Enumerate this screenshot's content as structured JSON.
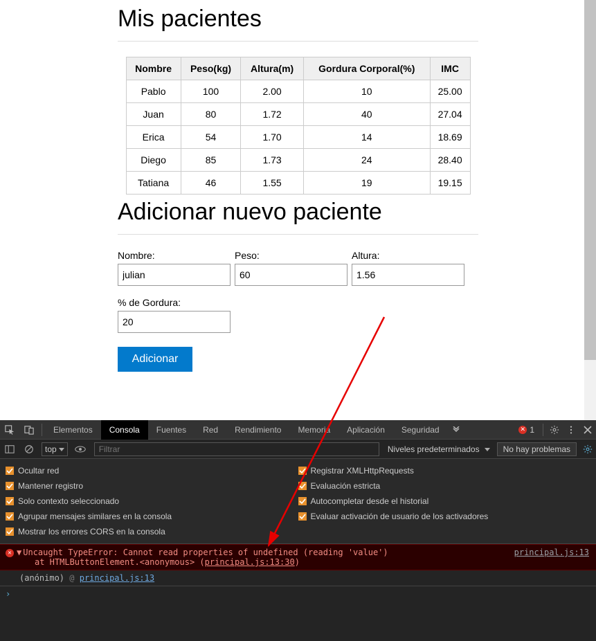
{
  "page": {
    "title": "Mis pacientes",
    "addTitle": "Adicionar nuevo paciente"
  },
  "table": {
    "headers": {
      "name": "Nombre",
      "weight": "Peso(kg)",
      "height": "Altura(m)",
      "fat": "Gordura Corporal(%)",
      "bmi": "IMC"
    },
    "rows": [
      {
        "name": "Pablo",
        "weight": "100",
        "height": "2.00",
        "fat": "10",
        "bmi": "25.00"
      },
      {
        "name": "Juan",
        "weight": "80",
        "height": "1.72",
        "fat": "40",
        "bmi": "27.04"
      },
      {
        "name": "Erica",
        "weight": "54",
        "height": "1.70",
        "fat": "14",
        "bmi": "18.69"
      },
      {
        "name": "Diego",
        "weight": "85",
        "height": "1.73",
        "fat": "24",
        "bmi": "28.40"
      },
      {
        "name": "Tatiana",
        "weight": "46",
        "height": "1.55",
        "fat": "19",
        "bmi": "19.15"
      }
    ]
  },
  "form": {
    "name": {
      "label": "Nombre:",
      "value": "julian"
    },
    "weight": {
      "label": "Peso:",
      "value": "60"
    },
    "height": {
      "label": "Altura:",
      "value": "1.56"
    },
    "fat": {
      "label": "% de Gordura:",
      "value": "20"
    },
    "submit": "Adicionar"
  },
  "devtools": {
    "tabs": {
      "elements": "Elementos",
      "console": "Consola",
      "sources": "Fuentes",
      "network": "Red",
      "performance": "Rendimiento",
      "memory": "Memoria",
      "application": "Aplicación",
      "security": "Seguridad"
    },
    "errorCount": "1",
    "contextTop": "top",
    "filterPlaceholder": "Filtrar",
    "levels": "Niveles predeterminados",
    "noProblems": "No hay problemas",
    "settings": {
      "left": [
        "Ocultar red",
        "Mantener registro",
        "Solo contexto seleccionado",
        "Agrupar mensajes similares en la consola",
        "Mostrar los errores CORS en la consola"
      ],
      "right": [
        "Registrar XMLHttpRequests",
        "Evaluación estricta",
        "Autocompletar desde el historial",
        "Evaluar activación de usuario de los activadores"
      ]
    },
    "error": {
      "message": "Uncaught TypeError: Cannot read properties of undefined (reading 'value')",
      "at": "at HTMLButtonElement.<anonymous> (",
      "atLink": "principal.js:13:30",
      "atClose": ")",
      "sourceLink": "principal.js:13",
      "stackFn": "(anónimo)",
      "stackAt": "@",
      "stackLink": "principal.js:13"
    },
    "promptChar": "›"
  }
}
